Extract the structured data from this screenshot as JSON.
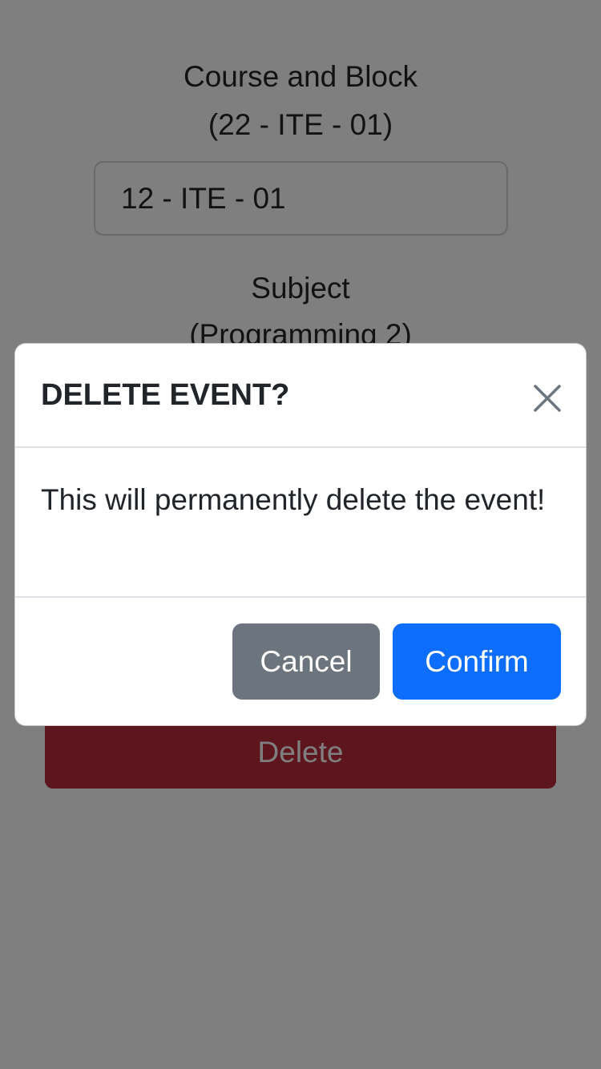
{
  "form": {
    "course_label": "Course and Block",
    "course_current": "(22 - ITE - 01)",
    "course_input_value": "12 - ITE - 01",
    "subject_label": "Subject",
    "subject_current": "(Programming 2)",
    "delete_label": "Delete"
  },
  "modal": {
    "title": "DELETE EVENT?",
    "close_icon": "close-icon",
    "body": "This will permanently delete the event!",
    "cancel_label": "Cancel",
    "confirm_label": "Confirm"
  },
  "colors": {
    "danger": "#bb2d3b",
    "secondary": "#6c757d",
    "primary": "#0d6efd"
  }
}
